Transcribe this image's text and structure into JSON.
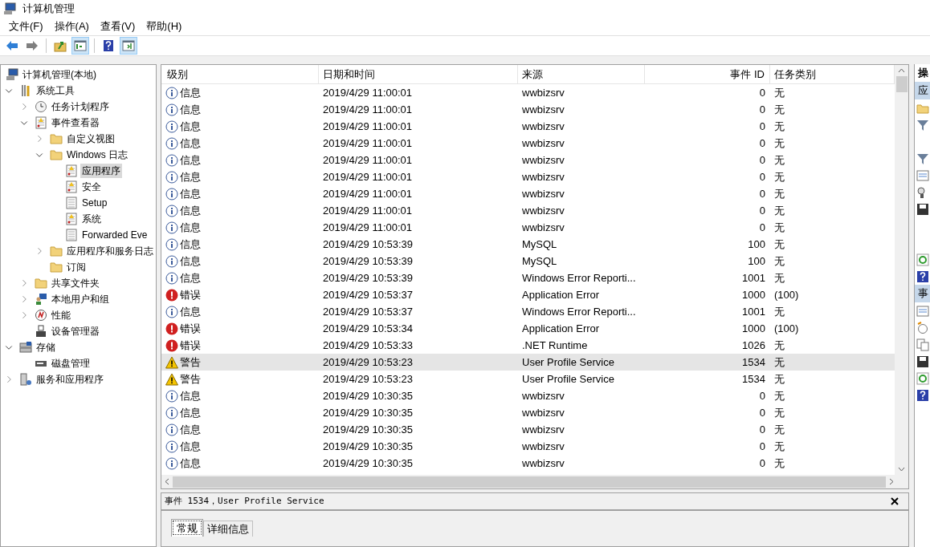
{
  "window": {
    "title": "计算机管理"
  },
  "menu": [
    "文件(F)",
    "操作(A)",
    "查看(V)",
    "帮助(H)"
  ],
  "toolbar": [
    {
      "kind": "back",
      "pressed": false
    },
    {
      "kind": "forward",
      "pressed": false
    },
    {
      "kind": "sep"
    },
    {
      "kind": "up",
      "pressed": false
    },
    {
      "kind": "tree",
      "pressed": true
    },
    {
      "kind": "sep"
    },
    {
      "kind": "help",
      "pressed": false
    },
    {
      "kind": "pane",
      "pressed": true
    }
  ],
  "tree": [
    {
      "label": "计算机管理(本地)",
      "selected": false,
      "children": [
        {
          "label": "系统工具",
          "expanded": true,
          "selected": false,
          "children": [
            {
              "label": "任务计划程序",
              "expanded": false,
              "selected": false
            },
            {
              "label": "事件查看器",
              "expanded": true,
              "selected": false,
              "children": [
                {
                  "label": "自定义视图",
                  "expanded": false,
                  "selected": false
                },
                {
                  "label": "Windows 日志",
                  "expanded": true,
                  "selected": false,
                  "children": [
                    {
                      "label": "应用程序",
                      "selected": true
                    },
                    {
                      "label": "安全",
                      "selected": false
                    },
                    {
                      "label": "Setup",
                      "selected": false
                    },
                    {
                      "label": "系统",
                      "selected": false
                    },
                    {
                      "label": "Forwarded Eve",
                      "selected": false
                    }
                  ]
                },
                {
                  "label": "应用程序和服务日志",
                  "expanded": false,
                  "selected": false
                },
                {
                  "label": "订阅",
                  "selected": false
                }
              ]
            },
            {
              "label": "共享文件夹",
              "expanded": false,
              "selected": false
            },
            {
              "label": "本地用户和组",
              "expanded": false,
              "selected": false
            },
            {
              "label": "性能",
              "expanded": false,
              "selected": false
            },
            {
              "label": "设备管理器",
              "selected": false
            }
          ]
        },
        {
          "label": "存储",
          "expanded": true,
          "selected": false,
          "children": [
            {
              "label": "磁盘管理",
              "selected": false
            }
          ]
        },
        {
          "label": "服务和应用程序",
          "expanded": false,
          "selected": false
        }
      ]
    }
  ],
  "table": {
    "columns": [
      "级别",
      "日期和时间",
      "来源",
      "事件 ID",
      "任务类别"
    ],
    "rows": [
      {
        "kind": "info",
        "level": "信息",
        "time": "2019/4/29 11:00:01",
        "source": "wwbizsrv",
        "id": "0",
        "category": "无",
        "selected": false
      },
      {
        "kind": "info",
        "level": "信息",
        "time": "2019/4/29 11:00:01",
        "source": "wwbizsrv",
        "id": "0",
        "category": "无",
        "selected": false
      },
      {
        "kind": "info",
        "level": "信息",
        "time": "2019/4/29 11:00:01",
        "source": "wwbizsrv",
        "id": "0",
        "category": "无",
        "selected": false
      },
      {
        "kind": "info",
        "level": "信息",
        "time": "2019/4/29 11:00:01",
        "source": "wwbizsrv",
        "id": "0",
        "category": "无",
        "selected": false
      },
      {
        "kind": "info",
        "level": "信息",
        "time": "2019/4/29 11:00:01",
        "source": "wwbizsrv",
        "id": "0",
        "category": "无",
        "selected": false
      },
      {
        "kind": "info",
        "level": "信息",
        "time": "2019/4/29 11:00:01",
        "source": "wwbizsrv",
        "id": "0",
        "category": "无",
        "selected": false
      },
      {
        "kind": "info",
        "level": "信息",
        "time": "2019/4/29 11:00:01",
        "source": "wwbizsrv",
        "id": "0",
        "category": "无",
        "selected": false
      },
      {
        "kind": "info",
        "level": "信息",
        "time": "2019/4/29 11:00:01",
        "source": "wwbizsrv",
        "id": "0",
        "category": "无",
        "selected": false
      },
      {
        "kind": "info",
        "level": "信息",
        "time": "2019/4/29 11:00:01",
        "source": "wwbizsrv",
        "id": "0",
        "category": "无",
        "selected": false
      },
      {
        "kind": "info",
        "level": "信息",
        "time": "2019/4/29 10:53:39",
        "source": "MySQL",
        "id": "100",
        "category": "无",
        "selected": false
      },
      {
        "kind": "info",
        "level": "信息",
        "time": "2019/4/29 10:53:39",
        "source": "MySQL",
        "id": "100",
        "category": "无",
        "selected": false
      },
      {
        "kind": "info",
        "level": "信息",
        "time": "2019/4/29 10:53:39",
        "source": "Windows Error Reporti...",
        "id": "1001",
        "category": "无",
        "selected": false
      },
      {
        "kind": "error",
        "level": "错误",
        "time": "2019/4/29 10:53:37",
        "source": "Application Error",
        "id": "1000",
        "category": "(100)",
        "selected": false
      },
      {
        "kind": "info",
        "level": "信息",
        "time": "2019/4/29 10:53:37",
        "source": "Windows Error Reporti...",
        "id": "1001",
        "category": "无",
        "selected": false
      },
      {
        "kind": "error",
        "level": "错误",
        "time": "2019/4/29 10:53:34",
        "source": "Application Error",
        "id": "1000",
        "category": "(100)",
        "selected": false
      },
      {
        "kind": "error",
        "level": "错误",
        "time": "2019/4/29 10:53:33",
        "source": ".NET Runtime",
        "id": "1026",
        "category": "无",
        "selected": false
      },
      {
        "kind": "warning",
        "level": "警告",
        "time": "2019/4/29 10:53:23",
        "source": "User Profile Service",
        "id": "1534",
        "category": "无",
        "selected": true
      },
      {
        "kind": "warning",
        "level": "警告",
        "time": "2019/4/29 10:53:23",
        "source": "User Profile Service",
        "id": "1534",
        "category": "无",
        "selected": false
      },
      {
        "kind": "info",
        "level": "信息",
        "time": "2019/4/29 10:30:35",
        "source": "wwbizsrv",
        "id": "0",
        "category": "无",
        "selected": false
      },
      {
        "kind": "info",
        "level": "信息",
        "time": "2019/4/29 10:30:35",
        "source": "wwbizsrv",
        "id": "0",
        "category": "无",
        "selected": false
      },
      {
        "kind": "info",
        "level": "信息",
        "time": "2019/4/29 10:30:35",
        "source": "wwbizsrv",
        "id": "0",
        "category": "无",
        "selected": false
      },
      {
        "kind": "info",
        "level": "信息",
        "time": "2019/4/29 10:30:35",
        "source": "wwbizsrv",
        "id": "0",
        "category": "无",
        "selected": false
      },
      {
        "kind": "info",
        "level": "信息",
        "time": "2019/4/29 10:30:35",
        "source": "wwbizsrv",
        "id": "0",
        "category": "无",
        "selected": false
      }
    ]
  },
  "detail": {
    "title": "事件 1534，User Profile Service",
    "tabs": [
      {
        "label": "常规",
        "selected": true
      },
      {
        "label": "详细信息",
        "selected": false
      }
    ]
  },
  "actions": {
    "title": "操",
    "sections": [
      {
        "label": "应"
      },
      {
        "label": "事"
      }
    ]
  }
}
